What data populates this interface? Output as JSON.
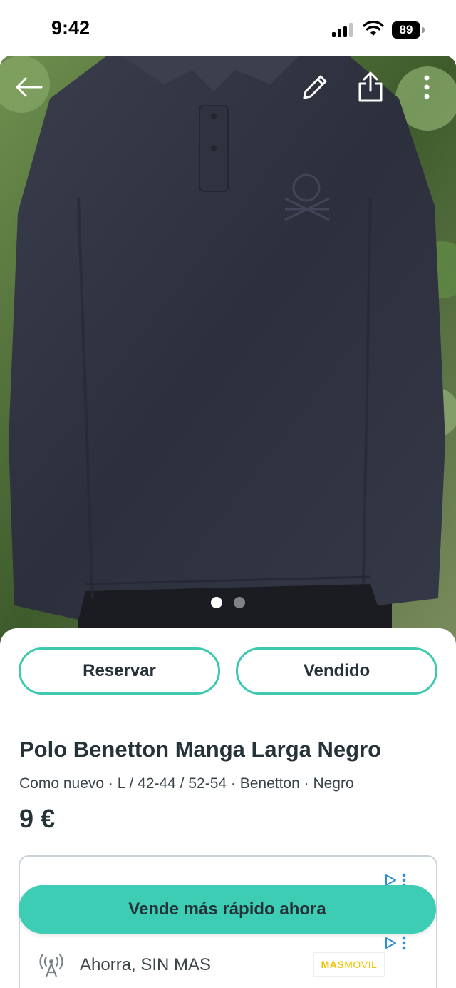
{
  "status_bar": {
    "time": "9:42",
    "battery": "89",
    "icons": [
      "signal-icon",
      "wifi-icon",
      "battery-icon"
    ]
  },
  "photo": {
    "toolbar_icons": [
      "back-arrow-icon",
      "pencil-icon",
      "share-icon",
      "more-vertical-icon"
    ],
    "image_count": 2,
    "active_index": 0
  },
  "actions": {
    "reserve_label": "Reservar",
    "sold_label": "Vendido"
  },
  "item": {
    "title": "Polo Benetton Manga Larga Negro",
    "meta": "Como nuevo · L / 42-44 / 52-54 · Benetton · Negro",
    "price": "9 €"
  },
  "ad": {
    "text": "Ahorra, SIN MAS",
    "logo_part1": "MAS",
    "logo_part2": "MOVIL",
    "icons": [
      "antenna-icon",
      "ad-choices-icon"
    ]
  },
  "cta": {
    "label": "Vende más rápido ahora"
  },
  "colors": {
    "accent": "#3dccb4",
    "text": "#253238"
  }
}
